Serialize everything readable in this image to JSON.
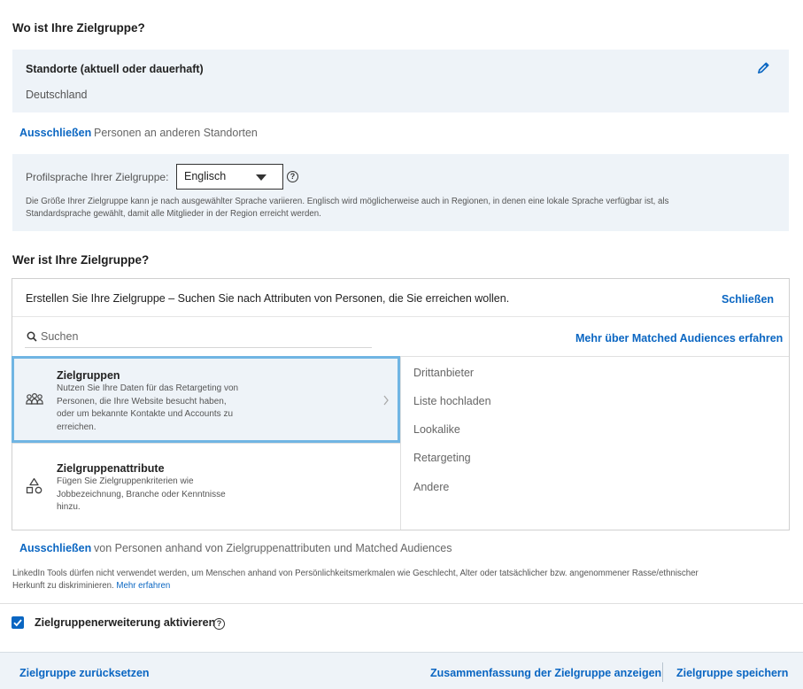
{
  "where": {
    "heading": "Wo ist Ihre Zielgruppe?",
    "locations_label": "Standorte (aktuell oder dauerhaft)",
    "locations_value": "Deutschland",
    "exclude_link": "Ausschließen",
    "exclude_text": "Personen an anderen Standorten"
  },
  "language": {
    "label": "Profilsprache Ihrer Zielgruppe:",
    "selected": "Englisch",
    "info_line1": "Die Größe Ihrer Zielgruppe kann je nach ausgewählter Sprache variieren. Englisch wird möglicherweise auch in Regionen, in denen eine lokale Sprache verfügbar ist, als",
    "info_line2": "Standardsprache gewählt, damit alle Mitglieder in der Region erreicht werden."
  },
  "who": {
    "heading": "Wer ist Ihre Zielgruppe?",
    "intro": "Erstellen Sie Ihre Zielgruppe – Suchen Sie nach Attributen von Personen, die Sie erreichen wollen.",
    "close_link": "Schließen",
    "search_placeholder": "Suchen",
    "matched_link": "Mehr über Matched Audiences erfahren",
    "categories": [
      {
        "title": "Zielgruppen",
        "desc": [
          "Nutzen Sie Ihre Daten für das Retargeting von",
          "Personen, die Ihre Website besucht haben,",
          "oder um bekannte Kontakte und Accounts zu",
          "erreichen."
        ]
      },
      {
        "title": "Zielgruppenattribute",
        "desc": [
          "Fügen Sie Zielgruppenkriterien wie",
          "Jobbezeichnung, Branche oder Kenntnisse",
          "hinzu."
        ]
      }
    ],
    "sub_items": [
      "Drittanbieter",
      "Liste hochladen",
      "Lookalike",
      "Retargeting",
      "Andere"
    ]
  },
  "exclude2": {
    "link": "Ausschließen",
    "text": "von Personen anhand von Zielgruppenattributen und Matched Audiences"
  },
  "disclaimer": {
    "line1": "LinkedIn Tools dürfen nicht verwendet werden, um Menschen anhand von Persönlichkeitsmerkmalen wie Geschlecht, Alter oder tatsächlicher bzw. angenommener Rasse/ethnischer",
    "line2": "Herkunft zu diskriminieren.",
    "link": "Mehr erfahren"
  },
  "expansion": {
    "label": "Zielgruppenerweiterung aktivieren",
    "checked": true
  },
  "footer": {
    "reset": "Zielgruppe zurücksetzen",
    "summary": "Zusammenfassung der Zielgruppe anzeigen",
    "save": "Zielgruppe speichern"
  },
  "colors": {
    "accent": "#0a66c2",
    "panel_bg": "#eef3f8",
    "selected_border": "#70b5e3"
  }
}
